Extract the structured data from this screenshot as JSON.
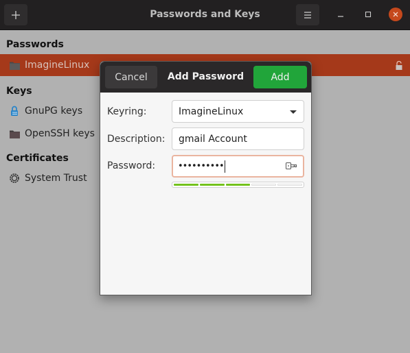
{
  "window": {
    "title": "Passwords and Keys",
    "add_icon": "plus-icon",
    "menu_icon": "hamburger-icon",
    "controls": [
      "minimize",
      "maximize",
      "close"
    ]
  },
  "sections": {
    "passwords": {
      "heading": "Passwords",
      "items": [
        {
          "label": "ImagineLinux",
          "icon": "folder-icon",
          "selected": true,
          "locked": false
        }
      ]
    },
    "keys": {
      "heading": "Keys",
      "items": [
        {
          "label": "GnuPG keys",
          "icon": "gnupg-icon"
        },
        {
          "label": "OpenSSH keys",
          "icon": "folder-icon"
        }
      ]
    },
    "certificates": {
      "heading": "Certificates",
      "items": [
        {
          "label": "System Trust",
          "icon": "gear-icon"
        }
      ]
    }
  },
  "dialog": {
    "title": "Add Password",
    "cancel_label": "Cancel",
    "add_label": "Add",
    "keyring_label": "Keyring:",
    "keyring_value": "ImagineLinux",
    "description_label": "Description:",
    "description_value": "gmail Account",
    "password_label": "Password:",
    "password_masked": "••••••••••",
    "strength": {
      "segments_filled": 3,
      "segments_total": 5
    }
  },
  "colors": {
    "selection": "#a5391a",
    "add_button": "#21a53a",
    "close_button": "#c5481c",
    "strength_bar": "#73c21c",
    "focus_border": "#eab49f"
  }
}
